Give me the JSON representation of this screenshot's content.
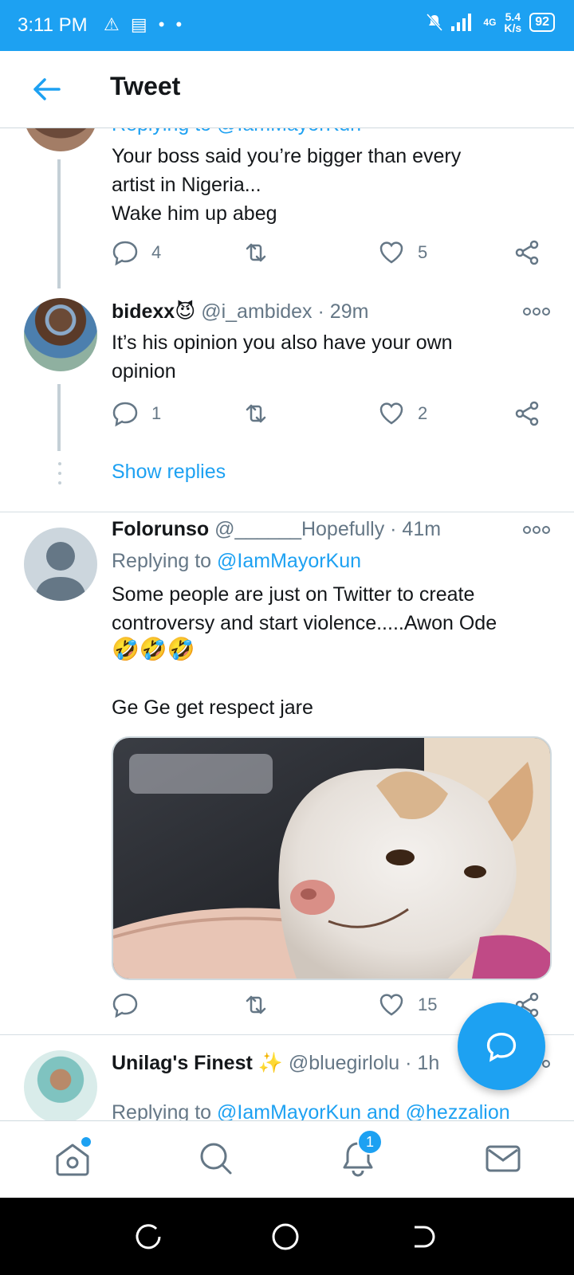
{
  "status_bar": {
    "time": "3:11 PM",
    "left_icons": "⚠ ▤ • •",
    "network": "4G",
    "speed_top": "5.4",
    "speed_bottom": "K/s",
    "battery": "92"
  },
  "header": {
    "title": "Tweet"
  },
  "tweets": [
    {
      "partial_reply": "Replying to @IamMayorKun",
      "text": [
        "Your boss said you’re bigger than every",
        "artist in Nigeria...",
        "Wake him up abeg"
      ],
      "replies": "4",
      "likes": "5"
    },
    {
      "name": "bidexx😈",
      "handle": "@i_ambidex",
      "time": "· 29m",
      "text": [
        "It’s his opinion you also have your own",
        "opinion"
      ],
      "replies": "1",
      "likes": "2"
    },
    {
      "name": "Folorunso",
      "handle": "@______Hopefully",
      "time": "· 41m",
      "replying_prefix": "Replying to ",
      "replying_to": "@IamMayorKun",
      "text": [
        "Some people are just on Twitter to create",
        "controversy and start violence.....Awon Ode"
      ],
      "emoji": "🤣🤣🤣",
      "text2": "Ge Ge get respect jare",
      "likes": "15"
    },
    {
      "name": "Unilag's Finest",
      "emoji": "✨",
      "handle": "@bluegirlolu",
      "time": "· 1h",
      "replying_prefix": "Replying to ",
      "replying_to": "@IamMayorKun and @hezzalion"
    }
  ],
  "show_replies": "Show replies",
  "notifications_badge": "1",
  "colors": {
    "accent": "#1da1f2",
    "muted": "#657786"
  }
}
